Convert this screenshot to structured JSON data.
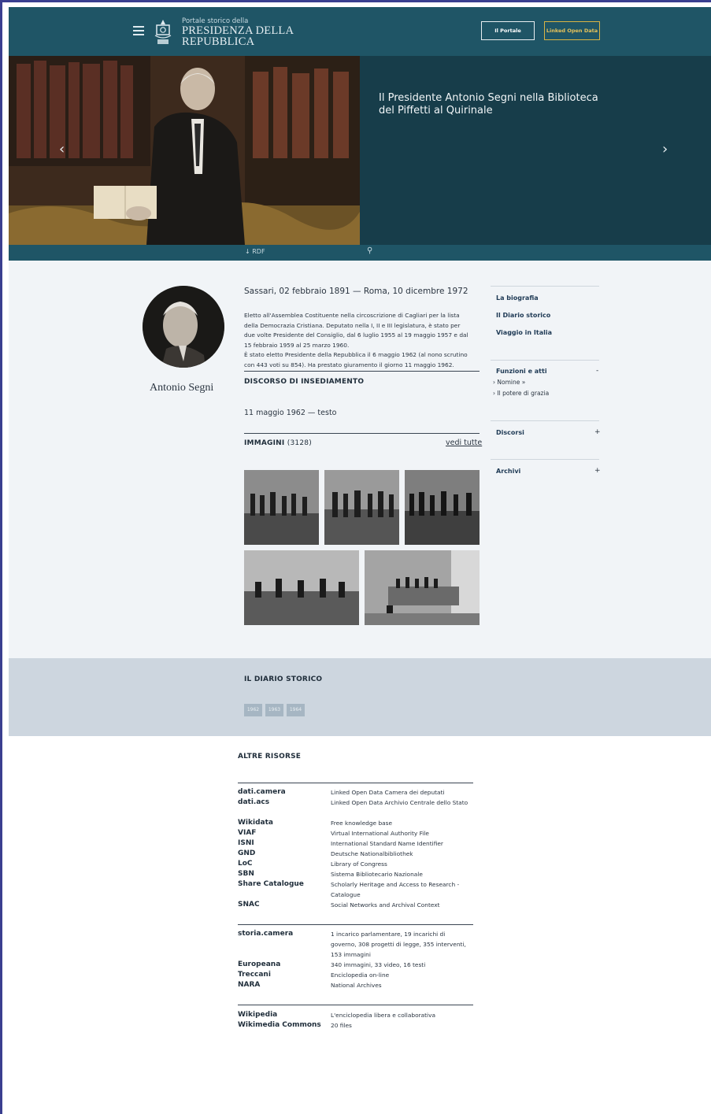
{
  "header": {
    "portal_small": "Portale storico della",
    "portal_title_line1": "PRESIDENZA DELLA",
    "portal_title_line2": "REPUBBLICA",
    "btn_portale": "Il Portale",
    "btn_lod": "Linked Open Data",
    "colors": {
      "bar": "#1f5566",
      "lod_accent": "#e6c25a"
    }
  },
  "hero": {
    "caption": "Il Presidente Antonio Segni nella Biblioteca del Piffetti al Quirinale",
    "rdf_label": "↓ RDF"
  },
  "person": {
    "name": "Antonio Segni",
    "dates": "Sassari, 02 febbraio 1891 — Roma, 10 dicembre 1972",
    "bio_lines": [
      "Eletto all'Assemblea Costituente nella circoscrizione di Cagliari per la lista",
      "della Democrazia Cristiana. Deputato nella I, II e III legislatura, è stato per",
      "due volte Presidente del Consiglio, dal 6 luglio 1955 al 19 maggio 1957 e dal",
      "15 febbraio 1959 al 25 marzo 1960.",
      "È stato eletto Presidente della Repubblica il 6 maggio 1962 (al nono scrutino",
      "con 443 voti su 854). Ha prestato giuramento il giorno 11 maggio 1962."
    ]
  },
  "discorso": {
    "heading": "DISCORSO DI INSEDIAMENTO",
    "item": "11 maggio 1962 — testo"
  },
  "immagini": {
    "heading": "IMMAGINI",
    "count": "(3128)",
    "see_all": "vedi tutte"
  },
  "side_menu": {
    "biografia": "La biografia",
    "diario": "Il Diario storico",
    "viaggio": "Viaggio in Italia",
    "funzioni": "Funzioni e atti",
    "funzioni_toggle": "-",
    "nomine": "› Nomine »",
    "grazia": "› Il potere di grazia",
    "discorsi": "Discorsi",
    "archivi": "Archivi",
    "plus": "+"
  },
  "diario_storico": {
    "heading": "IL DIARIO STORICO",
    "years": [
      "1962",
      "1963",
      "1964"
    ]
  },
  "altre_risorse": {
    "heading": "ALTRE RISORSE",
    "group1": [
      {
        "name": "dati.camera",
        "desc": "Linked Open Data Camera dei deputati"
      },
      {
        "name": "dati.acs",
        "desc": "Linked Open Data Archivio Centrale dello Stato"
      },
      {
        "name": "Wikidata",
        "desc": "Free knowledge base"
      },
      {
        "name": "VIAF",
        "desc": "Virtual International Authority File"
      },
      {
        "name": "ISNI",
        "desc": "International Standard Name Identifier"
      },
      {
        "name": "GND",
        "desc": "Deutsche Nationalbibliothek"
      },
      {
        "name": "LoC",
        "desc": "Library of Congress"
      },
      {
        "name": "SBN",
        "desc": "Sistema Bibliotecario Nazionale"
      },
      {
        "name": "Share Catalogue",
        "desc": "Scholarly Heritage and Access to Research - Catalogue"
      },
      {
        "name": "SNAC",
        "desc": "Social Networks and Archival Context"
      }
    ],
    "group2": [
      {
        "name": "storia.camera",
        "desc": "1 incarico parlamentare, 19 incarichi di governo, 308 progetti di legge, 355 interventi, 153 immagini"
      },
      {
        "name": "Europeana",
        "desc": "340 immagini, 33 video, 16 testi"
      },
      {
        "name": "Treccani",
        "desc": "Enciclopedia on-line"
      },
      {
        "name": "NARA",
        "desc": "National Archives"
      }
    ],
    "group3": [
      {
        "name": "Wikipedia",
        "desc": "L'enciclopedia libera e collaborativa"
      },
      {
        "name": "Wikimedia Commons",
        "desc": "20 files"
      }
    ]
  }
}
